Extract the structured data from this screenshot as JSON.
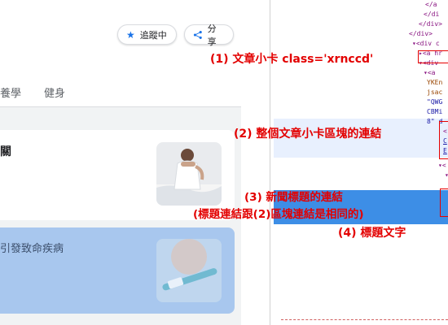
{
  "header": {
    "follow_label": "追蹤中",
    "share_label": "分享"
  },
  "tabs": [
    {
      "label": "養學"
    },
    {
      "label": "健身"
    }
  ],
  "articles": [
    {
      "title": "關"
    },
    {
      "title": "引發致命疾病"
    }
  ],
  "devtools": {
    "lines": [
      "</a",
      "</di",
      "</div>",
      "</div>",
      "▾<div c",
      "▸<a hr",
      "▾<div",
      "▾<a",
      "YKEn",
      "jsac",
      "\"QWG",
      "CBMi",
      "8\" d",
      "<",
      "C",
      "E",
      "▾<",
      "▾"
    ]
  },
  "annotations": {
    "a1": "(1) 文章小卡 class='xrnccd'",
    "a2": "(2) 整個文章小卡區塊的連結",
    "a3": "(3) 新聞標題的連結",
    "a3b": "(標題連結跟(2)區塊連結是相同的)",
    "a4": "(4) 標題文字"
  },
  "colors": {
    "annotation": "#e30000",
    "highlight": "#3d8ee6",
    "accent": "#1a73e8"
  }
}
